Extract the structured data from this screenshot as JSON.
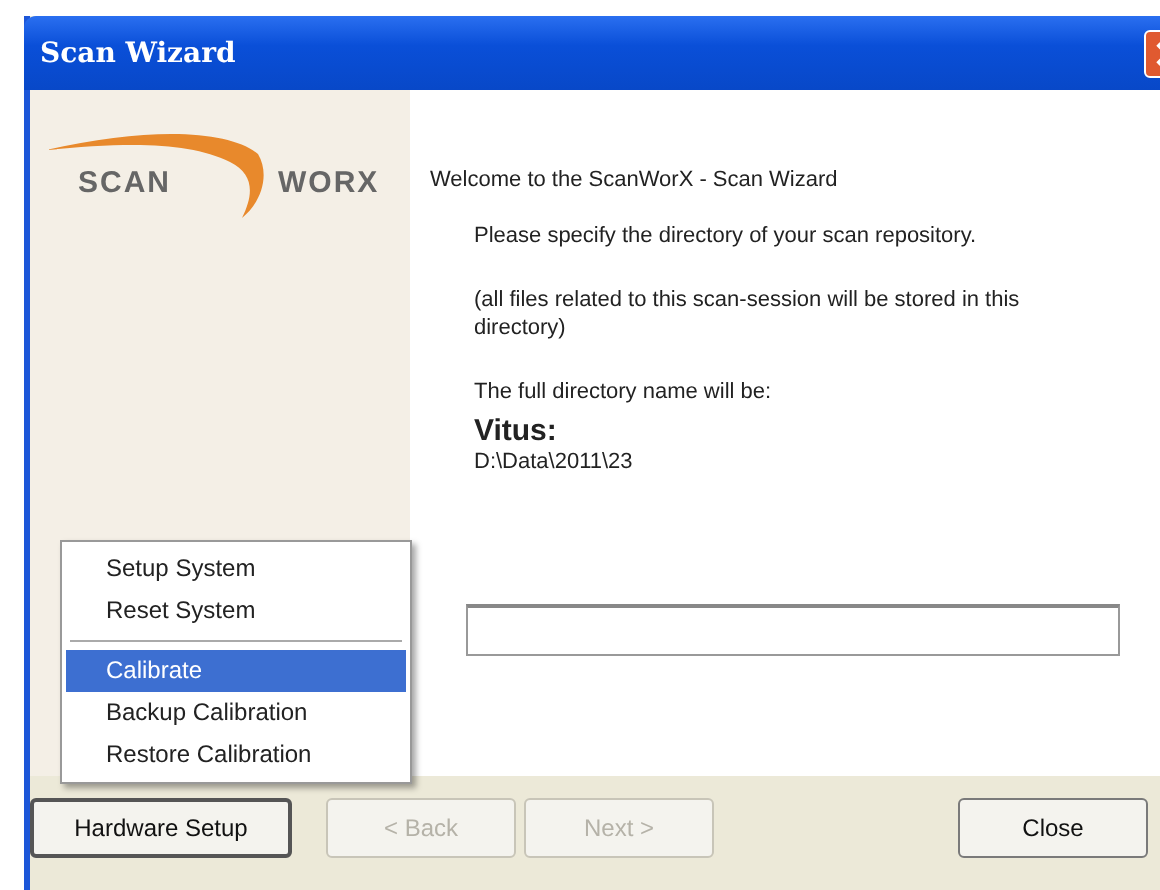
{
  "window": {
    "title": "Scan Wizard"
  },
  "logo": {
    "left": "SCAN",
    "right": "WORX"
  },
  "content": {
    "welcome": "Welcome to the ScanWorX - Scan Wizard",
    "instruction": "Please specify the directory of your scan repository.",
    "note": "(all files related to this scan-session will be stored in this directory)",
    "directory_label": "The full directory name will be:",
    "name": "Vitus:",
    "path": "D:\\Data\\2011\\23"
  },
  "menu": [
    {
      "kind": "item",
      "label": "Setup System",
      "selected": false
    },
    {
      "kind": "item",
      "label": "Reset System",
      "selected": false
    },
    {
      "kind": "separator"
    },
    {
      "kind": "item",
      "label": "Calibrate",
      "selected": true
    },
    {
      "kind": "item",
      "label": "Backup Calibration",
      "selected": false
    },
    {
      "kind": "item",
      "label": "Restore Calibration",
      "selected": false
    }
  ],
  "buttons": [
    {
      "label": "Hardware Setup",
      "disabled": false,
      "kind": "left"
    },
    {
      "label": "< Back",
      "disabled": true,
      "kind": "nav"
    },
    {
      "label": "Next >",
      "disabled": true,
      "kind": "nav"
    },
    {
      "label": "Close",
      "disabled": false,
      "kind": "right"
    }
  ]
}
